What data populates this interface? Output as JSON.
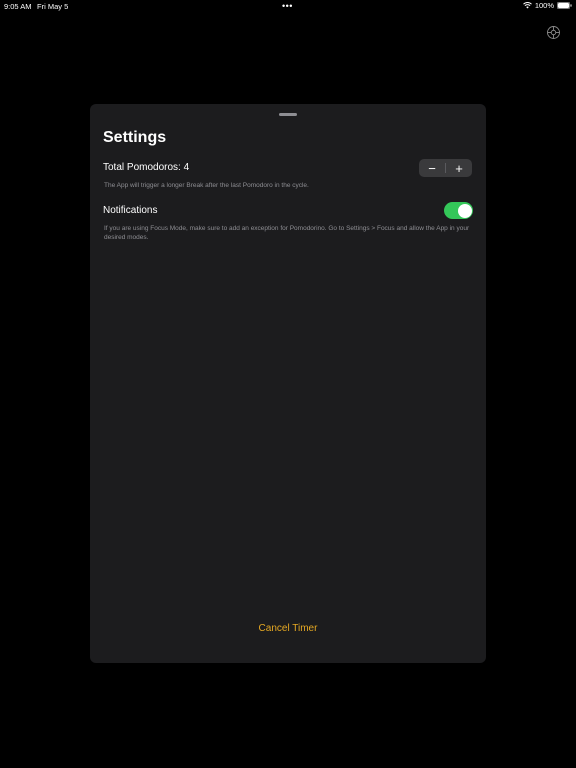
{
  "status_bar": {
    "time": "9:05 AM",
    "date": "Fri May 5",
    "dots": "•••",
    "battery_percent": "100%"
  },
  "settings": {
    "title": "Settings",
    "pomodoros": {
      "label": "Total Pomodoros: 4",
      "value": 4,
      "decrement_label": "−",
      "increment_label": "+",
      "footnote": "The App will trigger a longer Break after the last Pomodoro in the cycle."
    },
    "notifications": {
      "label": "Notifications",
      "enabled": true,
      "footnote": "If you are using Focus Mode, make sure to add an exception for Pomodorino. Go to Settings > Focus and allow the App in your desired modes."
    },
    "cancel_label": "Cancel Timer"
  },
  "colors": {
    "background": "#000000",
    "sheet": "#1c1c1e",
    "toggle_on": "#34c759",
    "accent": "#e5a823",
    "secondary_text": "#8e8e93"
  },
  "icons": {
    "top_right": "gear-icon",
    "status": [
      "wifi-icon",
      "battery-icon"
    ]
  }
}
